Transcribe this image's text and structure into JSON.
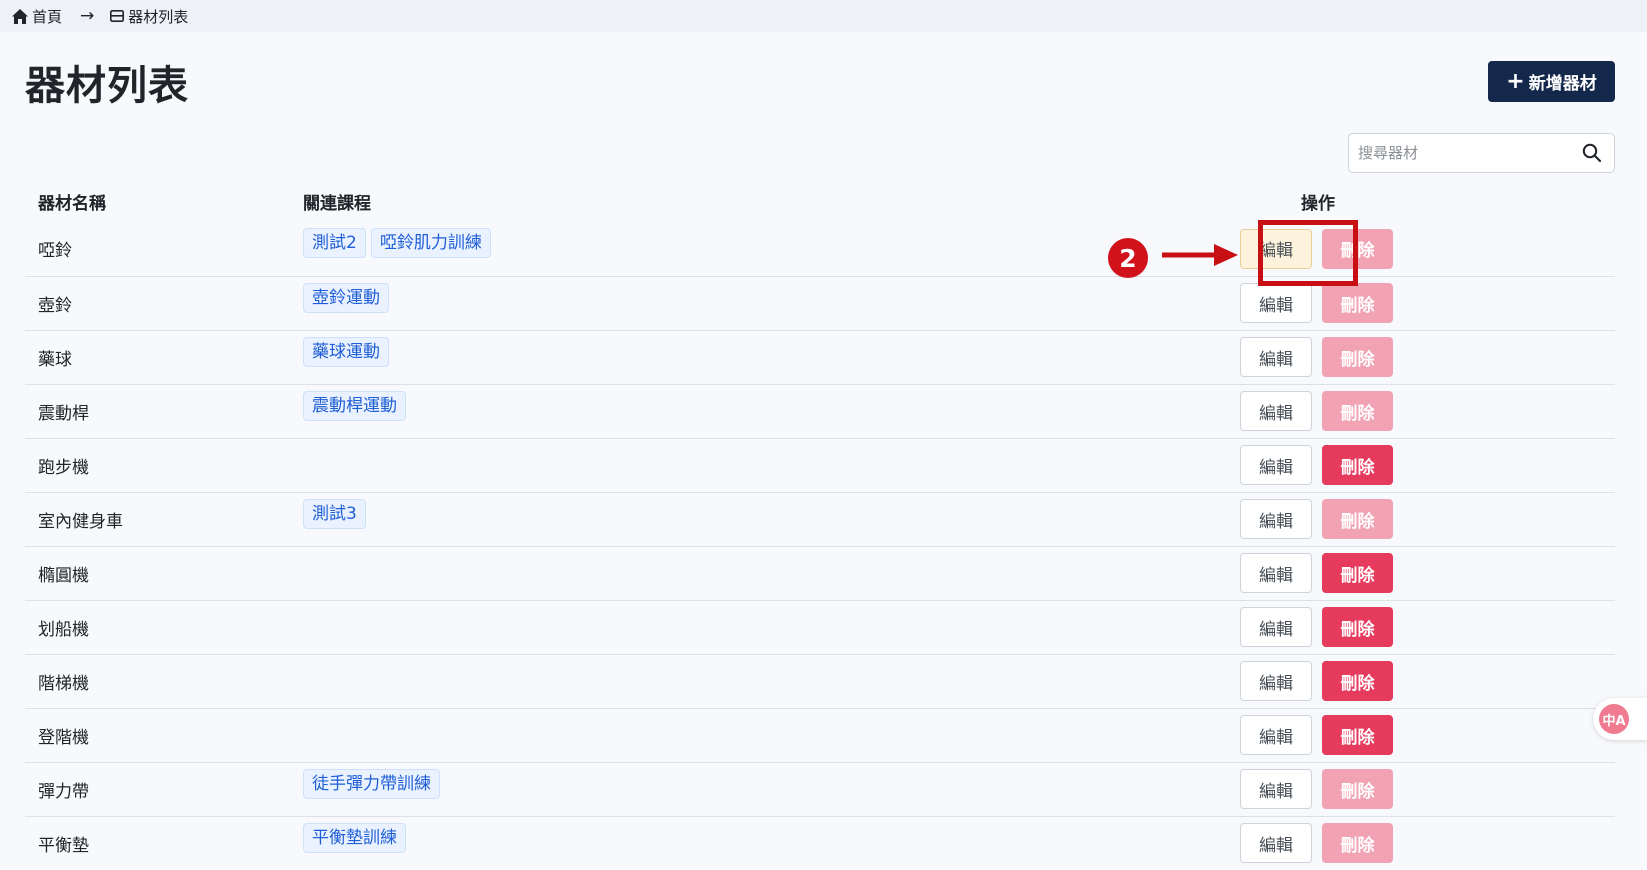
{
  "breadcrumb": {
    "home_label": "首頁",
    "current_label": "器材列表"
  },
  "page": {
    "title": "器材列表",
    "add_button_label": "新增器材"
  },
  "search": {
    "placeholder": "搜尋器材"
  },
  "table": {
    "headers": {
      "name": "器材名稱",
      "courses": "關連課程",
      "actions": "操作"
    },
    "edit_label": "編輯",
    "delete_label": "刪除",
    "rows": [
      {
        "name": "啞鈴",
        "courses": [
          "測試2",
          "啞鈴肌力訓練"
        ],
        "delete_enabled": false
      },
      {
        "name": "壺鈴",
        "courses": [
          "壺鈴運動"
        ],
        "delete_enabled": false
      },
      {
        "name": "藥球",
        "courses": [
          "藥球運動"
        ],
        "delete_enabled": false
      },
      {
        "name": "震動桿",
        "courses": [
          "震動桿運動"
        ],
        "delete_enabled": false
      },
      {
        "name": "跑步機",
        "courses": [],
        "delete_enabled": true
      },
      {
        "name": "室內健身車",
        "courses": [
          "測試3"
        ],
        "delete_enabled": false
      },
      {
        "name": "橢圓機",
        "courses": [],
        "delete_enabled": true
      },
      {
        "name": "划船機",
        "courses": [],
        "delete_enabled": true
      },
      {
        "name": "階梯機",
        "courses": [],
        "delete_enabled": true
      },
      {
        "name": "登階機",
        "courses": [],
        "delete_enabled": true
      },
      {
        "name": "彈力帶",
        "courses": [
          "徒手彈力帶訓練"
        ],
        "delete_enabled": false
      },
      {
        "name": "平衡墊",
        "courses": [
          "平衡墊訓練"
        ],
        "delete_enabled": false
      }
    ]
  },
  "annotation": {
    "step_number": "2"
  },
  "translate_fab": {
    "glyph": "中A"
  },
  "colors": {
    "primary_dark": "#14284b",
    "danger": "#e63b5c",
    "danger_disabled": "#f2a3b3",
    "tag_text": "#1f5fd6",
    "annotation_red": "#c80f14"
  }
}
